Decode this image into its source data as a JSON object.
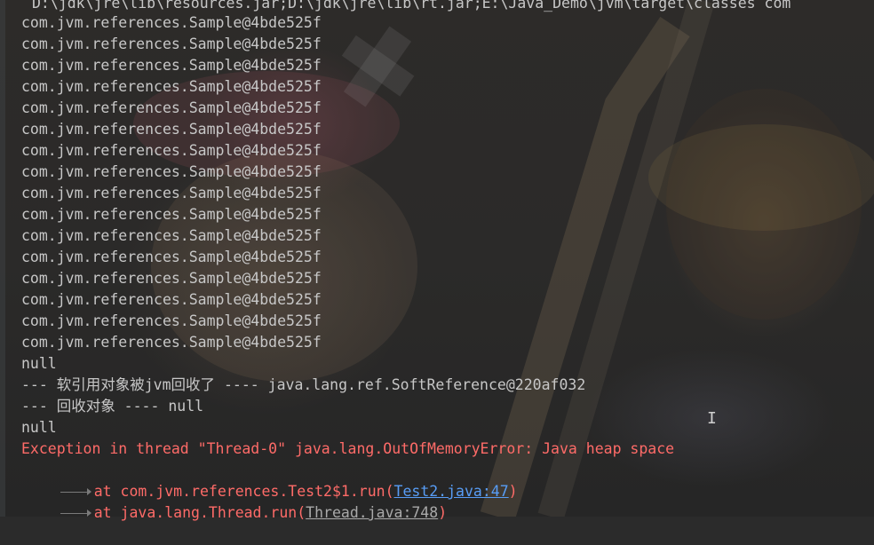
{
  "console": {
    "command_line": "D:\\jdk\\jre\\lib\\resources.jar;D:\\jdk\\jre\\lib\\rt.jar;E:\\Java_Demo\\jvm\\target\\classes com",
    "sample_lines": [
      "com.jvm.references.Sample@4bde525f",
      "com.jvm.references.Sample@4bde525f",
      "com.jvm.references.Sample@4bde525f",
      "com.jvm.references.Sample@4bde525f",
      "com.jvm.references.Sample@4bde525f",
      "com.jvm.references.Sample@4bde525f",
      "com.jvm.references.Sample@4bde525f",
      "com.jvm.references.Sample@4bde525f",
      "com.jvm.references.Sample@4bde525f",
      "com.jvm.references.Sample@4bde525f",
      "com.jvm.references.Sample@4bde525f",
      "com.jvm.references.Sample@4bde525f",
      "com.jvm.references.Sample@4bde525f",
      "com.jvm.references.Sample@4bde525f",
      "com.jvm.references.Sample@4bde525f",
      "com.jvm.references.Sample@4bde525f"
    ],
    "null_1": "null",
    "soft_ref_line": "--- 软引用对象被jvm回收了 ---- java.lang.ref.SoftReference@220af032",
    "recycled_line": "--- 回收对象 ---- null",
    "null_2": "null",
    "exception_line": "Exception in thread \"Thread-0\" java.lang.OutOfMemoryError: Java heap space",
    "stack": [
      {
        "prefix": "at com.jvm.references.Test2$1.run(",
        "link": "Test2.java:47",
        "suffix": ")"
      },
      {
        "prefix": "at java.lang.Thread.run(",
        "link": "Thread.java:748",
        "suffix": ")"
      }
    ],
    "colors": {
      "background": "#2b2b2b",
      "text": "#c7c7c7",
      "error": "#ff6b68",
      "link": "#589df6"
    },
    "cursor_icon": "text-cursor-icon"
  }
}
